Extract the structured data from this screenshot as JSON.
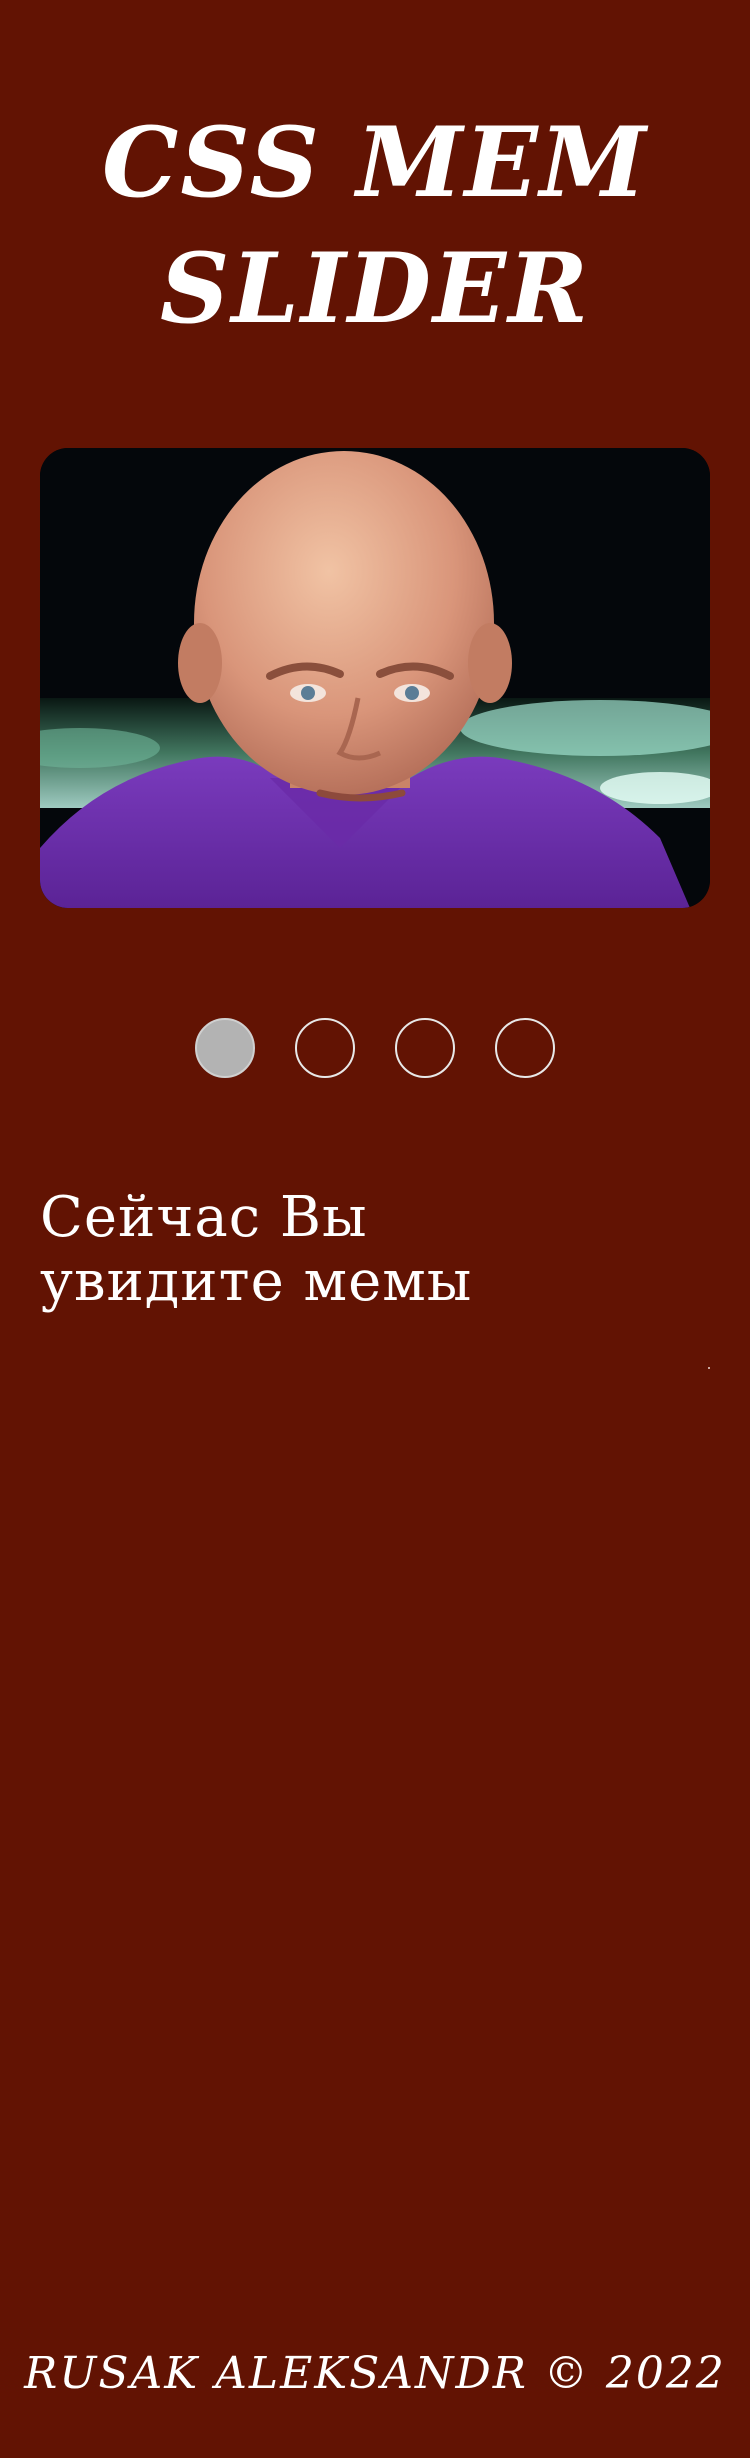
{
  "header": {
    "title": "CSS MEM SLIDER"
  },
  "slider": {
    "current_slide": 1,
    "slide_count": 4,
    "caption": "Сейчас Вы увидите мемы",
    "dots": [
      {
        "active": true
      },
      {
        "active": false
      },
      {
        "active": false
      },
      {
        "active": false
      }
    ]
  },
  "footer": {
    "text": "RUSAK ALEKSANDR © 2022"
  },
  "colors": {
    "background": "#621303",
    "text": "#ffffff",
    "dot_active": "#b3b3b3",
    "dot_border": "#e8e8e8"
  }
}
